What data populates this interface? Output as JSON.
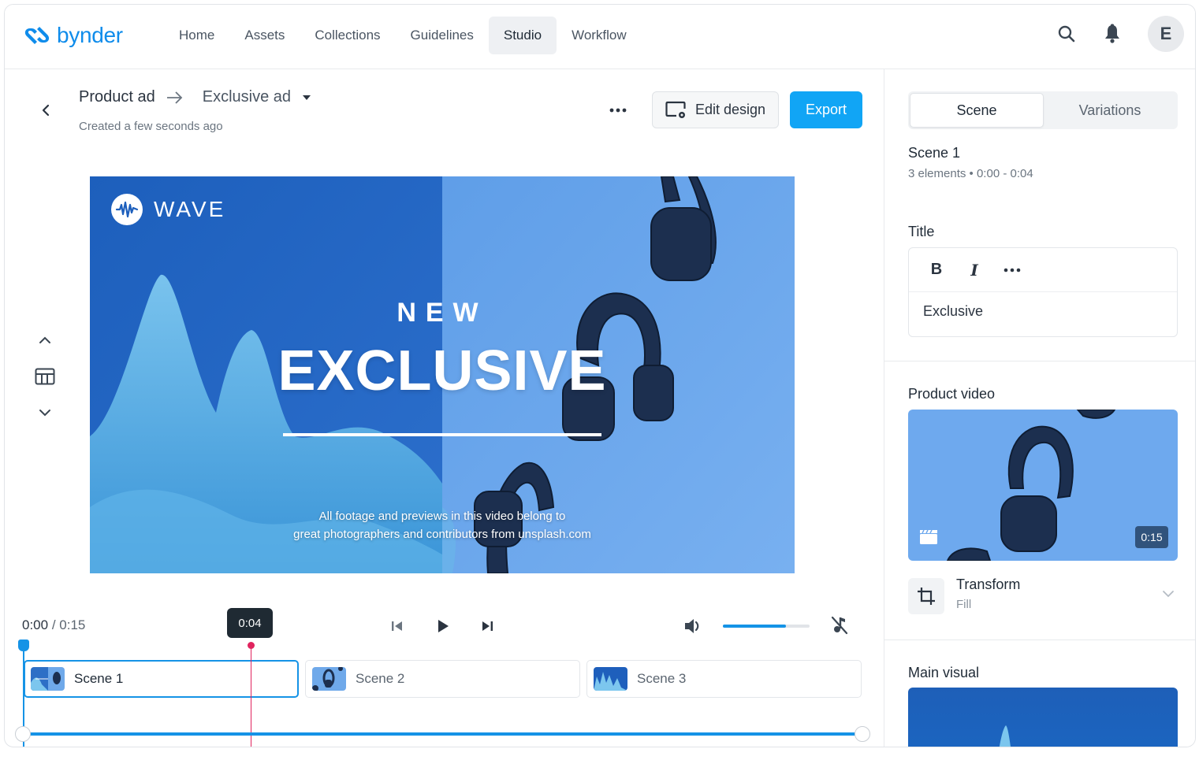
{
  "app": {
    "brand": "bynder",
    "brand_color": "#0f8ceb",
    "accent_color": "#11a5f5",
    "playhead_color": "#e0245e"
  },
  "nav": {
    "items": [
      {
        "label": "Home",
        "active": false
      },
      {
        "label": "Assets",
        "active": false
      },
      {
        "label": "Collections",
        "active": false
      },
      {
        "label": "Guidelines",
        "active": false
      },
      {
        "label": "Studio",
        "active": true
      },
      {
        "label": "Workflow",
        "active": false
      }
    ],
    "icons": [
      "search-icon",
      "bell-icon"
    ],
    "avatar_initial": "E"
  },
  "header": {
    "breadcrumb_parent": "Product ad",
    "breadcrumb_current": "Exclusive ad",
    "subtitle": "Created a few seconds ago",
    "edit_design_label": "Edit design",
    "export_label": "Export"
  },
  "preview": {
    "brand_name": "WAVE",
    "kicker": "NEW",
    "headline": "EXCLUSIVE",
    "credit_line_1": "All footage and previews in this video belong to",
    "credit_line_2": "great photographers and contributors from unsplash.com"
  },
  "playback": {
    "current_time": "0:00",
    "separator": "/",
    "total_time": "0:15",
    "playhead_tooltip": "0:04",
    "playhead_fraction": 0.267,
    "volume_fraction": 0.73
  },
  "timeline": {
    "scenes": [
      {
        "label": "Scene 1",
        "active": true
      },
      {
        "label": "Scene 2",
        "active": false
      },
      {
        "label": "Scene 3",
        "active": false
      }
    ],
    "range_start_fraction": 0,
    "range_end_fraction": 1
  },
  "panel": {
    "tabs": [
      {
        "label": "Scene",
        "active": true
      },
      {
        "label": "Variations",
        "active": false
      }
    ],
    "scene_name": "Scene 1",
    "scene_meta": "3 elements • 0:00 - 0:04",
    "title_label": "Title",
    "title_toolbar": {
      "bold": "B",
      "italic": "I",
      "more": "•••"
    },
    "title_value": "Exclusive",
    "product_video_label": "Product video",
    "product_video_duration": "0:15",
    "transform_label": "Transform",
    "transform_value": "Fill",
    "main_visual_label": "Main visual"
  }
}
